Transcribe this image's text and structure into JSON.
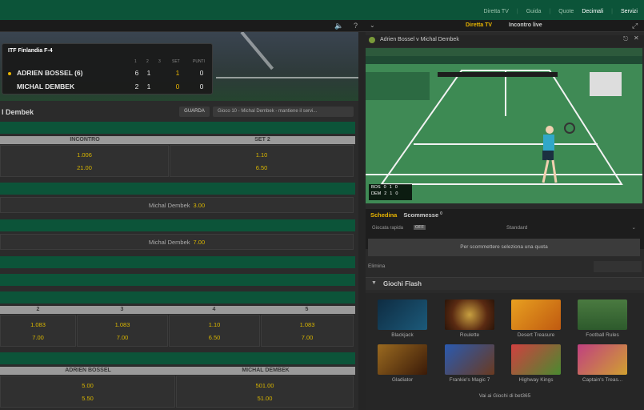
{
  "topbar": {
    "links": [
      "Diretta TV",
      "Guida",
      "Quote",
      "Decimali",
      "Servizi"
    ]
  },
  "scoreboard": {
    "title": "ITF Finlandia F-4",
    "headers": [
      "1",
      "2",
      "3",
      "SET",
      "PUNTI"
    ],
    "players": [
      {
        "name": "ADRIEN BOSSEL (6)",
        "s1": "6",
        "s2": "1",
        "set": "1",
        "pts": "0",
        "serving": true
      },
      {
        "name": "MICHAL DEMBEK",
        "s1": "2",
        "s2": "1",
        "set": "0",
        "pts": "0",
        "serving": false
      }
    ]
  },
  "match": {
    "title": "l Dembek",
    "watch_label": "GUARDA",
    "game_select": "Gioco 10 - Michal Dembek - mantiene il servi..."
  },
  "markets": {
    "m1": {
      "col1": "INCONTRO",
      "col2": "SET 2",
      "r1": [
        "1.006",
        "1.10"
      ],
      "r2": [
        "21.00",
        "6.50"
      ]
    },
    "m2": {
      "label": "Michal Dembek",
      "odds": "3.00"
    },
    "m3": {
      "label": "Michal Dembek",
      "odds": "7.00"
    },
    "m4": {
      "cols": [
        "2",
        "3",
        "4",
        "5"
      ],
      "r1": [
        "1.083",
        "1.083",
        "1.10",
        "1.083"
      ],
      "r2": [
        "7.00",
        "7.00",
        "6.50",
        "7.00"
      ]
    },
    "m5": {
      "col1": "ADRIEN BOSSEL",
      "col2": "MICHAL DEMBEK",
      "r1": [
        "5.00",
        "501.00"
      ],
      "r2": [
        "5.50",
        "51.00"
      ]
    }
  },
  "right": {
    "tabs": [
      "Diretta TV",
      "Incontro live"
    ],
    "video_title": "Adrien Bossel v Michal Dembek",
    "mini_score": [
      {
        "p": "BOS",
        "a": "0",
        "b": "1",
        "c": "0"
      },
      {
        "p": "DEM",
        "a": "2",
        "b": "1",
        "c": "0"
      }
    ],
    "bet_tabs": [
      "Schedina",
      "Scommesse"
    ],
    "bet_count": "0",
    "quick_bet": "Giocata rapida",
    "quick_bet_state": "OFF",
    "stake_select": "Standard",
    "empty_msg": "Per scommettere seleziona una quota",
    "remove_label": "Elimina",
    "games_title": "Giochi Flash",
    "games": [
      "Blackjack",
      "Roulette",
      "Desert Treasure",
      "Football Rules",
      "Gladiator",
      "Frankie's Magic 7",
      "Highway Kings",
      "Captain's Treas..."
    ],
    "all_games": "Vai ai Giochi di bet365"
  },
  "icons": [
    "volume-icon",
    "help-icon",
    "chevron-down-icon",
    "pin-icon",
    "expand-icon"
  ],
  "colors": {
    "brand_green": "#0c5439",
    "odds_yellow": "#d8b500",
    "accent": "#e8b400"
  }
}
